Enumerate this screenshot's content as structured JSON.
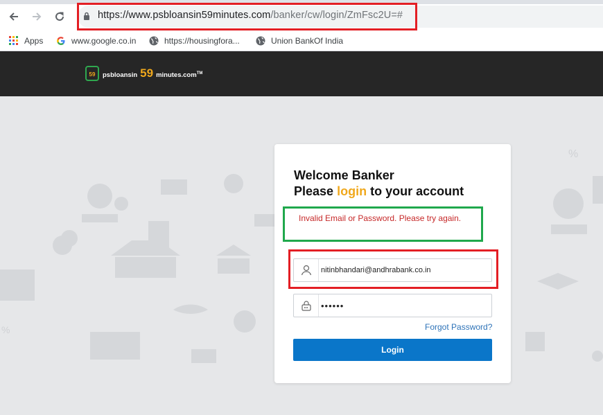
{
  "browser": {
    "url_host": "https://www.psbloansin59minutes.com",
    "url_path": "/banker/cw/login/ZmFsc2U=#",
    "bookmarks": [
      {
        "label": "Apps",
        "icon": "apps-grid-icon"
      },
      {
        "label": "www.google.co.in",
        "icon": "google-icon"
      },
      {
        "label": "https://housingfora...",
        "icon": "globe-icon"
      },
      {
        "label": "Union BankOf India",
        "icon": "globe-icon"
      }
    ]
  },
  "site": {
    "logo_prefix": "psbloansin",
    "logo_number": "59",
    "logo_suffix": "minutes.com",
    "logo_tm": "TM"
  },
  "login": {
    "heading_line1": "Welcome Banker",
    "heading_please": "Please",
    "heading_login": "login",
    "heading_rest": "to your account",
    "error_message": "Invalid Email or Password. Please try again.",
    "email_value": "nitinbhandari@andhrabank.co.in",
    "password_value": "••••••",
    "forgot_label": "Forgot Password?",
    "button_label": "Login"
  },
  "colors": {
    "accent": "#f0a81c",
    "button": "#0a76c9",
    "error": "#c62828",
    "annotation_red": "#e31e24",
    "annotation_green": "#1fa84c"
  }
}
